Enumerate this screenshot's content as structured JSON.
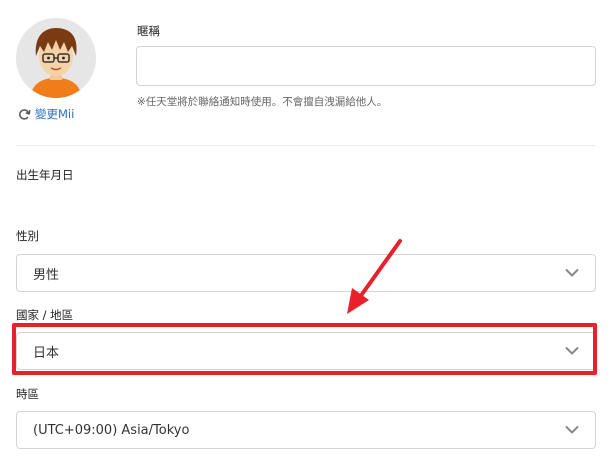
{
  "profile": {
    "change_mii_label": "變更Mii"
  },
  "nickname": {
    "label": "暱稱",
    "value": "",
    "placeholder": "",
    "hint": "※任天堂將於聯絡通知時使用。不會擅自洩漏給他人。"
  },
  "birthday": {
    "label": "出生年月日"
  },
  "gender": {
    "label": "性別",
    "selected": "男性"
  },
  "region": {
    "label": "國家 / 地區",
    "selected": "日本"
  },
  "timezone": {
    "label": "時區",
    "selected": "(UTC+09:00) Asia/Tokyo"
  },
  "annotation": {
    "color": "#e8202a"
  }
}
